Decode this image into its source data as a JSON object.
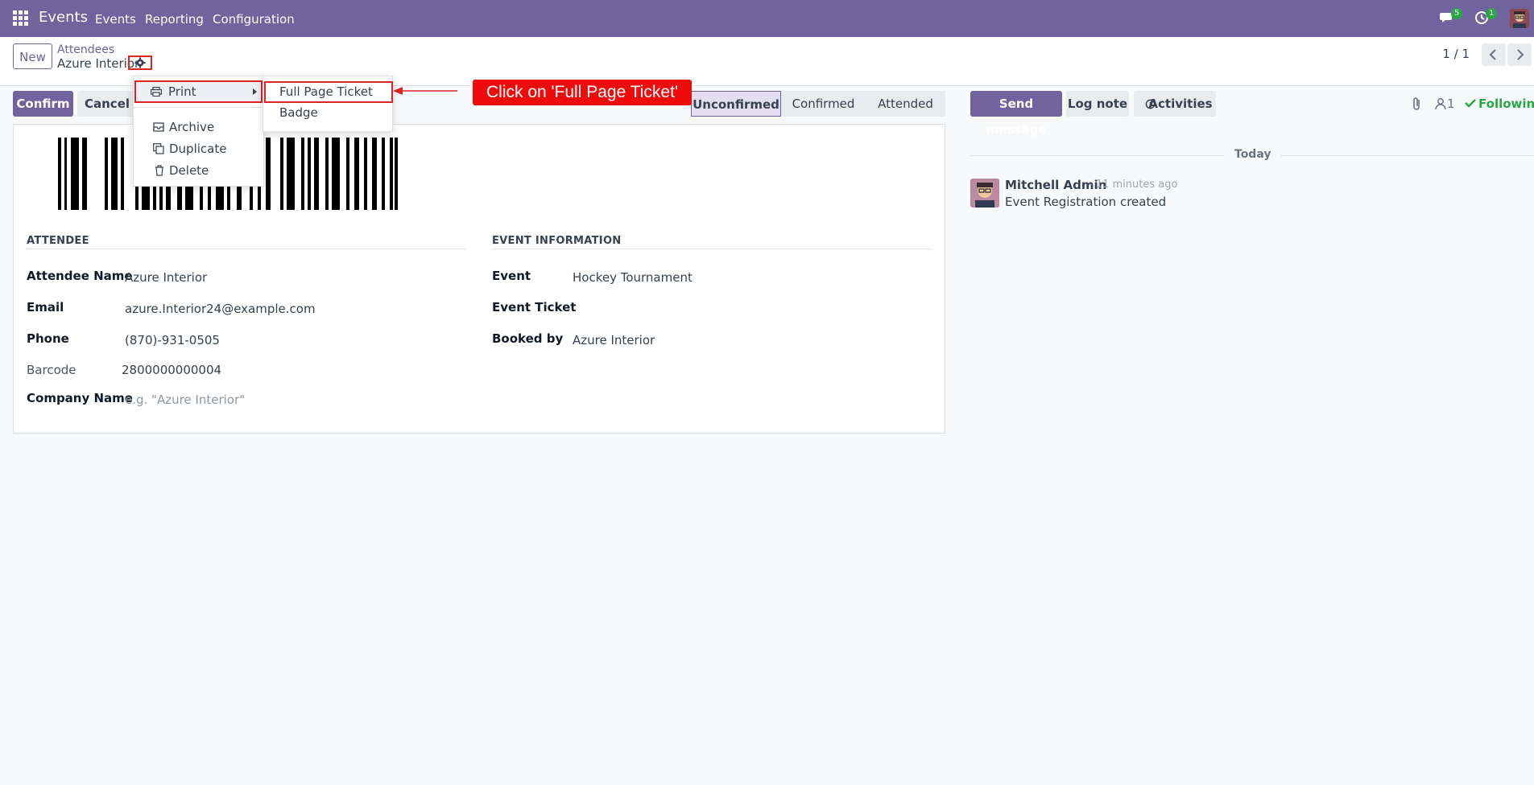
{
  "navbar": {
    "app_name": "Events",
    "menu": [
      "Events",
      "Reporting",
      "Configuration"
    ],
    "messages_count": "5",
    "activities_count": "1"
  },
  "control": {
    "new_label": "New",
    "breadcrumb_parent": "Attendees",
    "breadcrumb_current": "Azure Interior",
    "pager": "1 / 1"
  },
  "actions": {
    "confirm": "Confirm",
    "cancel": "Cancel Re"
  },
  "statusbar": [
    "Unconfirmed",
    "Confirmed",
    "Attended"
  ],
  "chatter_buttons": {
    "send_message": "Send message",
    "log_note": "Log note",
    "activities": "Activities",
    "followers": "1",
    "following": "Following"
  },
  "sections": {
    "attendee": "ATTENDEE",
    "event_info": "EVENT INFORMATION"
  },
  "attendee": {
    "name_label": "Attendee Name",
    "name": "Azure Interior",
    "email_label": "Email",
    "email": "azure.Interior24@example.com",
    "phone_label": "Phone",
    "phone": "(870)-931-0505",
    "barcode_label": "Barcode",
    "barcode": "2800000000004",
    "company_label": "Company Name",
    "company_placeholder": "e.g. \"Azure Interior\""
  },
  "event": {
    "event_label": "Event",
    "event": "Hockey Tournament",
    "ticket_label": "Event Ticket",
    "booked_label": "Booked by",
    "booked_by": "Azure Interior"
  },
  "chatter": {
    "today": "Today",
    "author": "Mitchell Admin",
    "time": "- 11 minutes ago",
    "message": "Event Registration created"
  },
  "dropdown": {
    "print": "Print",
    "archive": "Archive",
    "duplicate": "Duplicate",
    "delete": "Delete"
  },
  "submenu": {
    "full_page_ticket": "Full Page Ticket",
    "badge": "Badge"
  },
  "callout": "Click on 'Full Page Ticket'",
  "colors": {
    "brand": "#71639e",
    "highlight": "#e02424",
    "following": "#28a745"
  }
}
